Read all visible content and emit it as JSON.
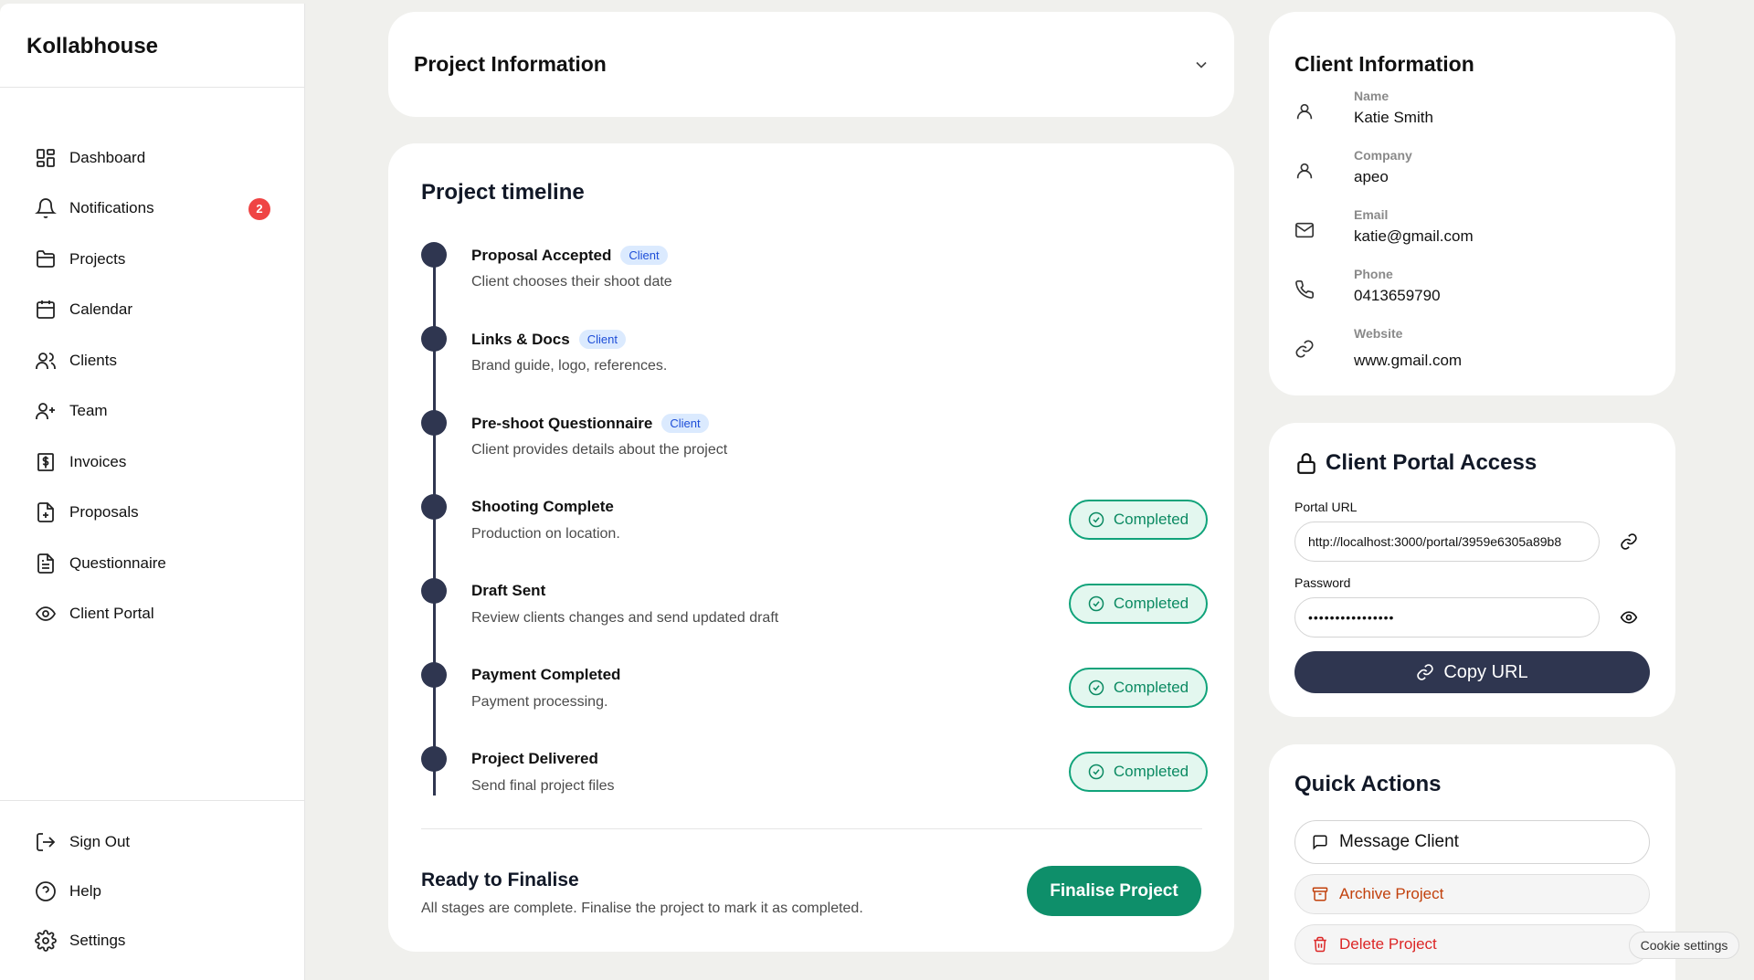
{
  "sidebar": {
    "brand": "Kollabhouse",
    "items": [
      {
        "label": "Dashboard",
        "icon": "dashboard-icon"
      },
      {
        "label": "Notifications",
        "icon": "bell-icon",
        "badge": "2"
      },
      {
        "label": "Projects",
        "icon": "folder-icon"
      },
      {
        "label": "Calendar",
        "icon": "calendar-icon"
      },
      {
        "label": "Clients",
        "icon": "users-icon"
      },
      {
        "label": "Team",
        "icon": "user-plus-icon"
      },
      {
        "label": "Invoices",
        "icon": "invoice-icon"
      },
      {
        "label": "Proposals",
        "icon": "file-plus-icon"
      },
      {
        "label": "Questionnaire",
        "icon": "file-text-icon"
      },
      {
        "label": "Client Portal",
        "icon": "eye-icon"
      }
    ],
    "bottom": [
      {
        "label": "Sign Out",
        "icon": "sign-out-icon"
      },
      {
        "label": "Help",
        "icon": "help-icon"
      },
      {
        "label": "Settings",
        "icon": "gear-icon"
      }
    ]
  },
  "project_info": {
    "title": "Project Information"
  },
  "timeline": {
    "title": "Project timeline",
    "client_tag": "Client",
    "completed_label": "Completed",
    "steps": [
      {
        "title": "Proposal Accepted",
        "desc": "Client chooses their shoot date",
        "client": true
      },
      {
        "title": "Links & Docs",
        "desc": "Brand guide, logo, references.",
        "client": true
      },
      {
        "title": "Pre-shoot Questionnaire",
        "desc": "Client provides details about the project",
        "client": true
      },
      {
        "title": "Shooting Complete",
        "desc": "Production on location.",
        "completed": true
      },
      {
        "title": "Draft Sent",
        "desc": "Review clients changes and send updated draft",
        "completed": true
      },
      {
        "title": "Payment Completed",
        "desc": "Payment processing.",
        "completed": true
      },
      {
        "title": "Project Delivered",
        "desc": "Send final project files",
        "completed": true
      }
    ],
    "ready_title": "Ready to Finalise",
    "ready_desc": "All stages are complete. Finalise the project to mark it as completed.",
    "finalise_label": "Finalise Project"
  },
  "client_info": {
    "title": "Client Information",
    "fields": [
      {
        "label": "Name",
        "value": "Katie Smith",
        "icon": "user-icon"
      },
      {
        "label": "Company",
        "value": "apeo",
        "icon": "user-icon"
      },
      {
        "label": "Email",
        "value": "katie@gmail.com",
        "icon": "mail-icon"
      },
      {
        "label": "Phone",
        "value": "0413659790",
        "icon": "phone-icon"
      },
      {
        "label": "Website",
        "value": "www.gmail.com",
        "icon": "link-icon"
      }
    ]
  },
  "portal": {
    "title": "Client Portal Access",
    "url_label": "Portal URL",
    "url_value": "http://localhost:3000/portal/3959e6305a89b8",
    "password_label": "Password",
    "password_value": "••••••••••••••••",
    "copy_label": "Copy URL"
  },
  "quick_actions": {
    "title": "Quick Actions",
    "message_label": "Message Client",
    "archive_label": "Archive Project",
    "delete_label": "Delete Project"
  },
  "cookie_label": "Cookie settings",
  "colors": {
    "accent_dark": "#2f3650",
    "success": "#0e8f6a",
    "danger": "#dc2626",
    "warning": "#c2410c",
    "badge": "#ef4444"
  }
}
